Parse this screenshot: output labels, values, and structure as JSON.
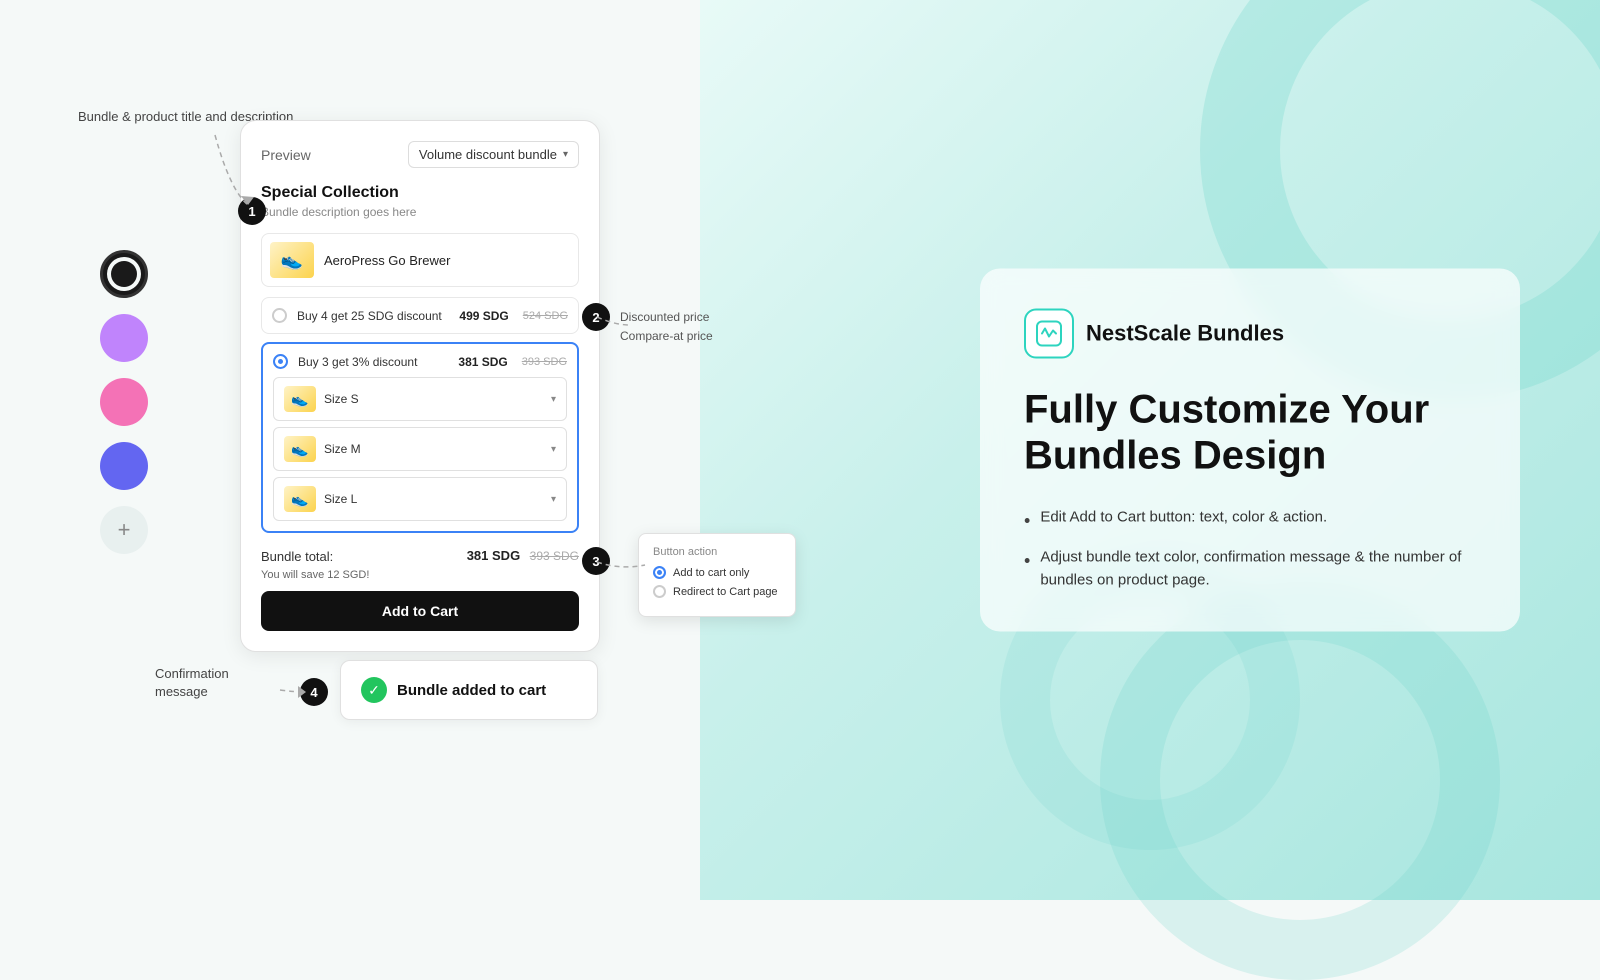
{
  "background": {
    "gradient_start": "#e8faf7",
    "gradient_end": "#a8e6df"
  },
  "annotations": {
    "label_1": "Bundle & product\ntitle and description",
    "label_confirm": "Confirmation\nmessage",
    "label_discounted_1": "Discounted price",
    "label_discounted_2": "Compare-at price"
  },
  "steps": {
    "step1": "1",
    "step2": "2",
    "step3": "3",
    "step4": "4"
  },
  "preview": {
    "label": "Preview",
    "dropdown_label": "Volume discount bundle",
    "bundle_title": "Special Collection",
    "bundle_description": "Bundle description goes here",
    "product_name": "AeroPress Go Brewer",
    "options": [
      {
        "label": "Buy 4 get 25 SDG discount",
        "price": "499 SDG",
        "compare_price": "524 SDG",
        "selected": false
      },
      {
        "label": "Buy 3 get 3% discount",
        "price": "381 SDG",
        "compare_price": "393 SDG",
        "selected": true
      }
    ],
    "size_options": [
      {
        "label": "Size S"
      },
      {
        "label": "Size M"
      },
      {
        "label": "Size L"
      }
    ],
    "bundle_total_label": "Bundle total:",
    "bundle_total_price": "381 SDG",
    "bundle_total_compare": "393 SDG",
    "bundle_save_text": "You will save 12 SGD!",
    "add_to_cart_label": "Add to Cart"
  },
  "button_action": {
    "title": "Button action",
    "options": [
      {
        "label": "Add to cart only",
        "selected": true
      },
      {
        "label": "Redirect to Cart page",
        "selected": false
      }
    ]
  },
  "confirmation": {
    "text": "Bundle added to cart"
  },
  "brand": {
    "name": "NestScale Bundles",
    "logo_alt": "nestscale-logo"
  },
  "heading": {
    "line1": "Fully Customize Your",
    "line2": "Bundles Design"
  },
  "features": [
    {
      "text": "Edit Add to Cart button: text, color & action."
    },
    {
      "text": "Adjust bundle text color, confirmation message & the number of bundles on product page."
    }
  ],
  "swatches": {
    "colors": [
      "black",
      "purple",
      "pink",
      "indigo"
    ],
    "add_label": "+"
  }
}
